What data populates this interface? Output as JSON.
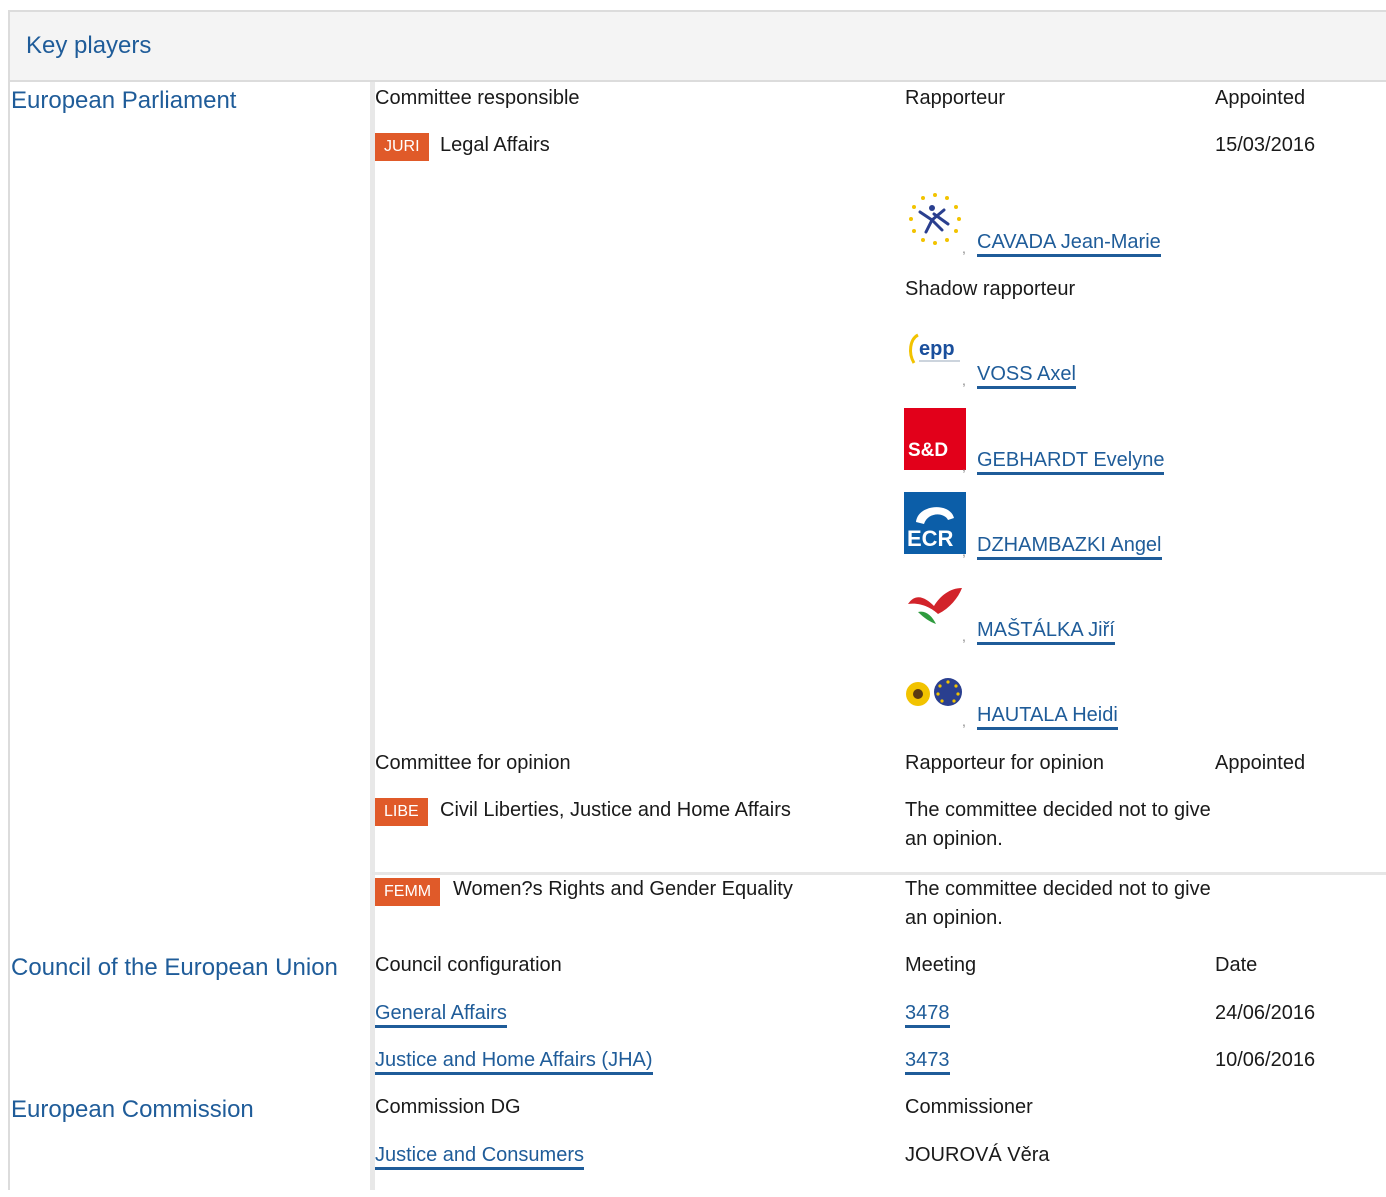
{
  "section_title": "Key players",
  "ep": {
    "institution": "European Parliament",
    "responsible_header": {
      "committee": "Committee responsible",
      "rapporteur": "Rapporteur",
      "appointed": "Appointed"
    },
    "responsible": {
      "code": "JURI",
      "name": "Legal Affairs",
      "appointed": "15/03/2016"
    },
    "rapporteur": {
      "name": "CAVADA Jean-Marie",
      "group_icon": "alde-logo-icon"
    },
    "shadow_label": "Shadow rapporteur",
    "shadows": [
      {
        "name": "VOSS Axel",
        "group_icon": "epp-logo-icon",
        "logo_text": "epp"
      },
      {
        "name": "GEBHARDT Evelyne",
        "group_icon": "sd-logo-icon",
        "logo_text": "S&D"
      },
      {
        "name": "DZHAMBAZKI Angel",
        "group_icon": "ecr-logo-icon",
        "logo_text": "ECR"
      },
      {
        "name": "MAŠTÁLKA Jiří",
        "group_icon": "gue-ngl-logo-icon"
      },
      {
        "name": "HAUTALA Heidi",
        "group_icon": "greens-efa-logo-icon"
      }
    ],
    "opinion_header": {
      "committee": "Committee for opinion",
      "rapporteur": "Rapporteur for opinion",
      "appointed": "Appointed"
    },
    "opinions": [
      {
        "code": "LIBE",
        "name": "Civil Liberties, Justice and Home Affairs",
        "note": "The committee decided not to give an opinion."
      },
      {
        "code": "FEMM",
        "name": "Women?s Rights and Gender Equality",
        "note": "The committee decided not to give an opinion."
      }
    ]
  },
  "council": {
    "institution": "Council of the European Union",
    "header": {
      "config": "Council configuration",
      "meeting": "Meeting",
      "date": "Date"
    },
    "rows": [
      {
        "config": "General Affairs",
        "meeting": "3478",
        "date": "24/06/2016"
      },
      {
        "config": "Justice and Home Affairs (JHA)",
        "meeting": "3473",
        "date": "10/06/2016"
      }
    ]
  },
  "commission": {
    "institution": "European Commission",
    "header": {
      "dg": "Commission DG",
      "commissioner": "Commissioner"
    },
    "dg": "Justice and Consumers",
    "commissioner": "JOUROVÁ Věra"
  },
  "colors": {
    "link": "#1f5c99",
    "badge": "#e05a29",
    "header_bg": "#f4f4f4"
  }
}
